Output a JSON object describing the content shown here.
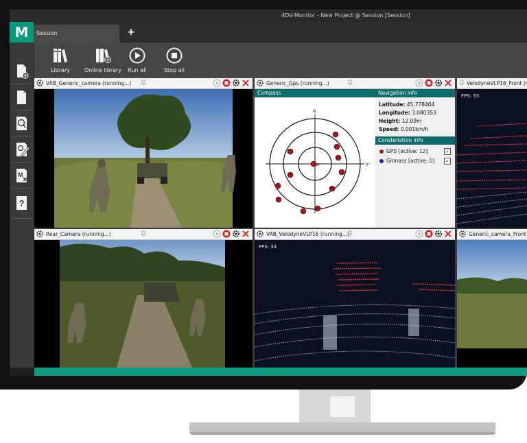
{
  "window": {
    "title": "4DV-Monitor - New Project @ Session [Session]"
  },
  "app": {
    "logo_letter": "M",
    "accent": "#009b7d"
  },
  "tabs": [
    {
      "label": "Session"
    }
  ],
  "tab_add": "+",
  "sidebar": {
    "items": [
      {
        "icon": "new-document-icon"
      },
      {
        "icon": "document-icon"
      },
      {
        "icon": "open-file-search-icon"
      },
      {
        "icon": "edit-document-icon"
      },
      {
        "icon": "document-m-close-icon"
      },
      {
        "icon": "help-question-icon"
      }
    ],
    "bottom_icon": "exit-door-icon",
    "help_glyph": "?",
    "m_glyph": "M"
  },
  "toolbar": {
    "library": "Library",
    "online_library": "Online library",
    "run_all": "Run all",
    "stop_all": "Stop all"
  },
  "panels": {
    "cam_generic": {
      "title": "VAB_Generic_camera (running...)"
    },
    "gps": {
      "title": "Generic_Gps (running...)"
    },
    "velodyne_front": {
      "title": "VelodyneVLP16_Front (running...)",
      "fps": "FPS: 33"
    },
    "rear_camera": {
      "title": "Rear_Camera (running...)"
    },
    "vab_velodyne": {
      "title": "VAB_VelodyneVLP16 (running...)",
      "fps": "FPS: 34"
    },
    "cam_front": {
      "title": "Generic_camera_Front (running...)"
    }
  },
  "gps": {
    "compass_label": "Compass",
    "north": "N",
    "east_deg": "0°",
    "center_deg": "90°",
    "nav_title": "Navigation info",
    "latitude_label": "Latitude:",
    "latitude": "45.778404",
    "longitude_label": "Longitude:",
    "longitude": "3.080353",
    "height_label": "Height:",
    "height": "12.09m",
    "speed_label": "Speed:",
    "speed": "0.001km/h",
    "const_title": "Constellation info",
    "gps_row": "GPS [active: 12]",
    "glonass_row": "Glonass [active: 0]",
    "gps_color": "#b01515",
    "glonass_color": "#1a2aa8",
    "check": "✓"
  },
  "colors": {
    "status_bar": "#0e9a7e",
    "section_header": "#0c6b6b"
  }
}
